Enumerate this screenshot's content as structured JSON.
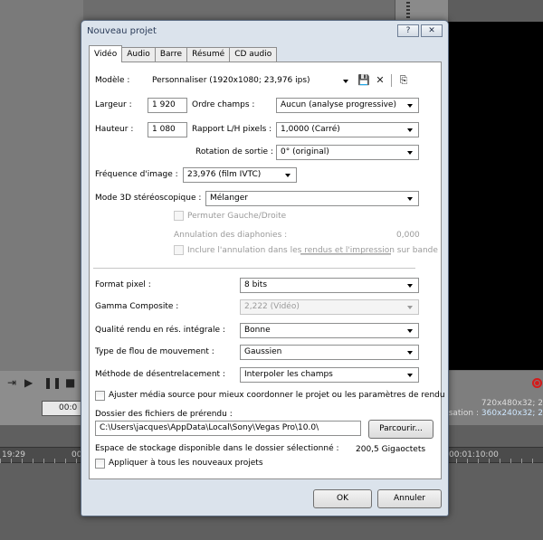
{
  "background": {
    "timecode": "00:0",
    "info_line1": "720x480x32; 2",
    "info_line2_label": "isation :",
    "info_line2_value": "360x240x32; 2",
    "ruler_left": "19:29",
    "ruler_mid": "00",
    "ruler_right": "00:01:10:00"
  },
  "dialog": {
    "title": "Nouveau projet",
    "help_button": "?",
    "close_button": "✕",
    "tabs": [
      "Vidéo",
      "Audio",
      "Barre",
      "Résumé",
      "CD audio"
    ],
    "video": {
      "template_label": "Modèle :",
      "template_value": "Personnaliser (1920x1080; 23,976 ips)",
      "width_label": "Largeur :",
      "width_value": "1 920",
      "height_label": "Hauteur :",
      "height_value": "1 080",
      "field_order_label": "Ordre champs :",
      "field_order_value": "Aucun (analyse progressive)",
      "aspect_label": "Rapport L/H pixels :",
      "aspect_value": "1,0000 (Carré)",
      "rotation_label": "Rotation de sortie :",
      "rotation_value": "0° (original)",
      "framerate_label": "Fréquence d'image :",
      "framerate_value": "23,976 (film IVTC)",
      "stereo_label": "Mode 3D stéréoscopique :",
      "stereo_value": "Mélanger",
      "swap_lr_label": "Permuter Gauche/Droite",
      "crosstalk_label": "Annulation des diaphonies :",
      "crosstalk_value": "0,000",
      "include_crosstalk_label": "Inclure l'annulation dans les rendus et l'impression sur bande",
      "pixel_format_label": "Format pixel :",
      "pixel_format_value": "8 bits",
      "gamma_label": "Gamma Composite :",
      "gamma_value": "2,222 (Vidéo)",
      "render_quality_label": "Qualité rendu en rés. intégrale :",
      "render_quality_value": "Bonne",
      "motion_blur_label": "Type de flou de mouvement :",
      "motion_blur_value": "Gaussien",
      "deinterlace_label": "Méthode de désentrelacement :",
      "deinterlace_value": "Interpoler les champs",
      "adjust_media_label": "Ajuster média source pour mieux coordonner le projet ou les paramètres de rendu",
      "prerender_folder_label": "Dossier des fichiers de prérendu :",
      "prerender_folder_value": "C:\\Users\\jacques\\AppData\\Local\\Sony\\Vegas Pro\\10.0\\",
      "browse_button": "Parcourir...",
      "free_space_label": "Espace de stockage disponible dans le dossier sélectionné :",
      "free_space_value": "200,5 Gigaoctets",
      "apply_all_label": "Appliquer à tous les nouveaux projets"
    },
    "ok_button": "OK",
    "cancel_button": "Annuler"
  }
}
